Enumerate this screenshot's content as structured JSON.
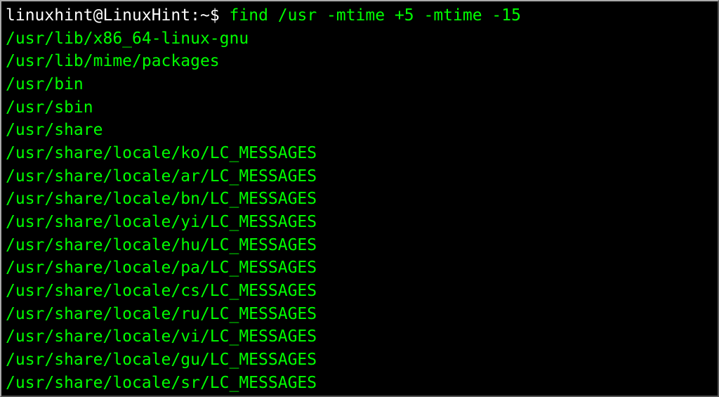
{
  "prompt": {
    "user_host": "linuxhint@LinuxHint",
    "separator": ":",
    "path": "~",
    "symbol": "$"
  },
  "command": "find /usr -mtime +5 -mtime -15",
  "output": [
    "/usr/lib/x86_64-linux-gnu",
    "/usr/lib/mime/packages",
    "/usr/bin",
    "/usr/sbin",
    "/usr/share",
    "/usr/share/locale/ko/LC_MESSAGES",
    "/usr/share/locale/ar/LC_MESSAGES",
    "/usr/share/locale/bn/LC_MESSAGES",
    "/usr/share/locale/yi/LC_MESSAGES",
    "/usr/share/locale/hu/LC_MESSAGES",
    "/usr/share/locale/pa/LC_MESSAGES",
    "/usr/share/locale/cs/LC_MESSAGES",
    "/usr/share/locale/ru/LC_MESSAGES",
    "/usr/share/locale/vi/LC_MESSAGES",
    "/usr/share/locale/gu/LC_MESSAGES",
    "/usr/share/locale/sr/LC_MESSAGES"
  ]
}
